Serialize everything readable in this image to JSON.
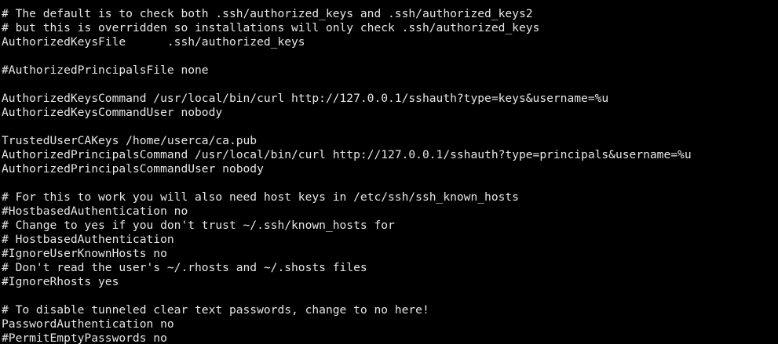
{
  "terminal": {
    "foreground": "#e6e6e6",
    "background": "#000000",
    "lines": [
      "# The default is to check both .ssh/authorized_keys and .ssh/authorized_keys2",
      "# but this is overridden so installations will only check .ssh/authorized_keys",
      "AuthorizedKeysFile      .ssh/authorized_keys",
      "",
      "#AuthorizedPrincipalsFile none",
      "",
      "AuthorizedKeysCommand /usr/local/bin/curl http://127.0.0.1/sshauth?type=keys&username=%u",
      "AuthorizedKeysCommandUser nobody",
      "",
      "TrustedUserCAKeys /home/userca/ca.pub",
      "AuthorizedPrincipalsCommand /usr/local/bin/curl http://127.0.0.1/sshauth?type=principals&username=%u",
      "AuthorizedPrincipalsCommandUser nobody",
      "",
      "# For this to work you will also need host keys in /etc/ssh/ssh_known_hosts",
      "#HostbasedAuthentication no",
      "# Change to yes if you don't trust ~/.ssh/known_hosts for",
      "# HostbasedAuthentication",
      "#IgnoreUserKnownHosts no",
      "# Don't read the user's ~/.rhosts and ~/.shosts files",
      "#IgnoreRhosts yes",
      "",
      "# To disable tunneled clear text passwords, change to no here!",
      "PasswordAuthentication no",
      "#PermitEmptyPasswords no"
    ]
  }
}
